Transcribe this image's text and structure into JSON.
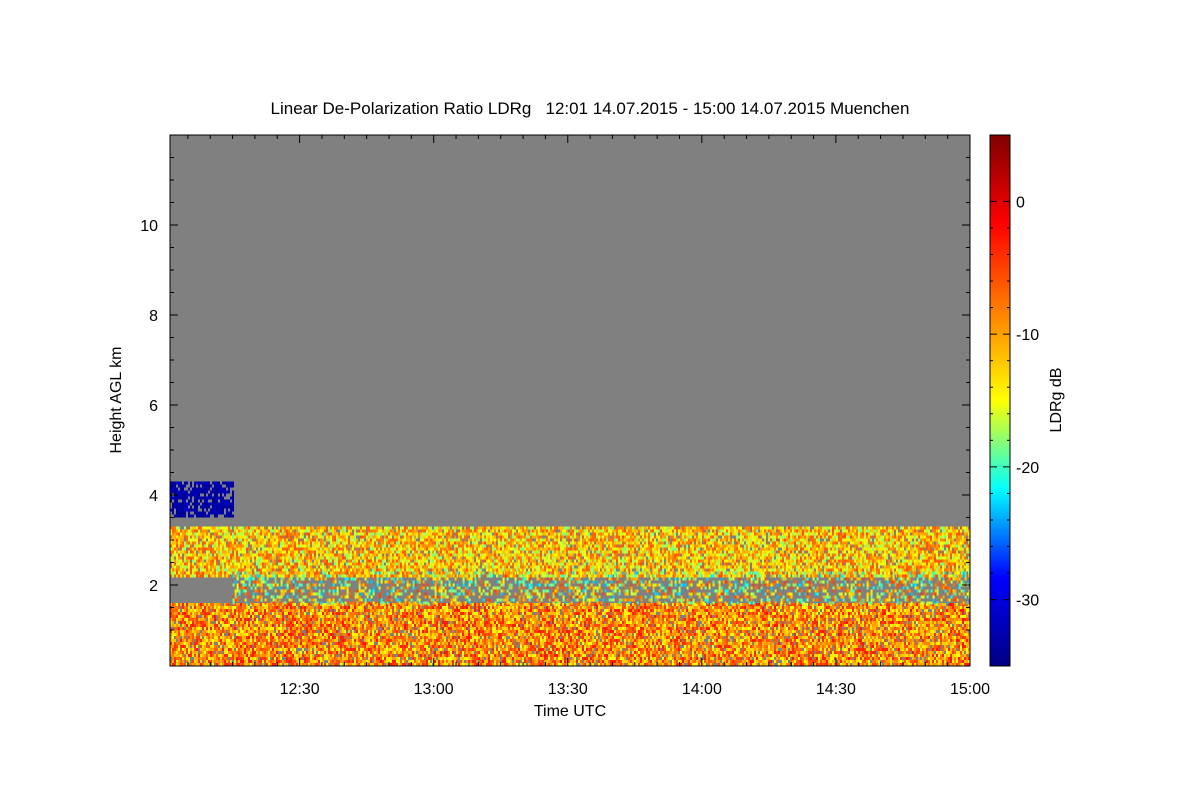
{
  "chart_data": {
    "type": "heatmap",
    "title": "Linear De-Polarization Ratio LDRg   12:01 14.07.2015 - 15:00 14.07.2015 Muenchen",
    "xlabel": "Time UTC",
    "ylabel": "Height AGL km",
    "x_ticks": [
      "12:30",
      "13:00",
      "13:30",
      "14:00",
      "14:30",
      "15:00"
    ],
    "x_tick_minutes": [
      750,
      780,
      810,
      840,
      870,
      900
    ],
    "xlim_minutes": [
      721,
      900
    ],
    "y_ticks": [
      "2",
      "4",
      "6",
      "8",
      "10"
    ],
    "y_tick_values": [
      2,
      4,
      6,
      8,
      10
    ],
    "ylim_km": [
      0.2,
      12
    ],
    "colorbar": {
      "label": "LDRg dB",
      "ticks": [
        "0",
        "-10",
        "-20",
        "-30"
      ],
      "tick_values": [
        0,
        -10,
        -20,
        -30
      ],
      "range_db": [
        -35,
        5
      ],
      "colors": [
        "#000080",
        "#0000ff",
        "#00ffff",
        "#ffff00",
        "#ff8000",
        "#ff0000",
        "#800000"
      ]
    },
    "background_color": "#808080",
    "layers": [
      {
        "kind": "boundary-layer",
        "time_start": 721,
        "time_end": 900,
        "height_base_km": 0.2,
        "height_top_km": 1.6,
        "mean_ldr_db": -9,
        "spread_db": 4
      },
      {
        "kind": "aerosol-layer",
        "time_start": 721,
        "time_end": 900,
        "height_base_km": 2.2,
        "height_top_km": 3.3,
        "mean_ldr_db": -12,
        "spread_db": 4
      },
      {
        "kind": "gap-region",
        "time_start": 735,
        "time_end": 900,
        "height_base_km": 1.6,
        "height_top_km": 2.3,
        "mean_ldr_db": -14,
        "spread_db": 6
      },
      {
        "kind": "ice-cloud",
        "time_start": 721,
        "time_end": 735,
        "height_base_km": 3.5,
        "height_top_km": 4.3,
        "mean_ldr_db": -33,
        "spread_db": 1
      }
    ]
  }
}
